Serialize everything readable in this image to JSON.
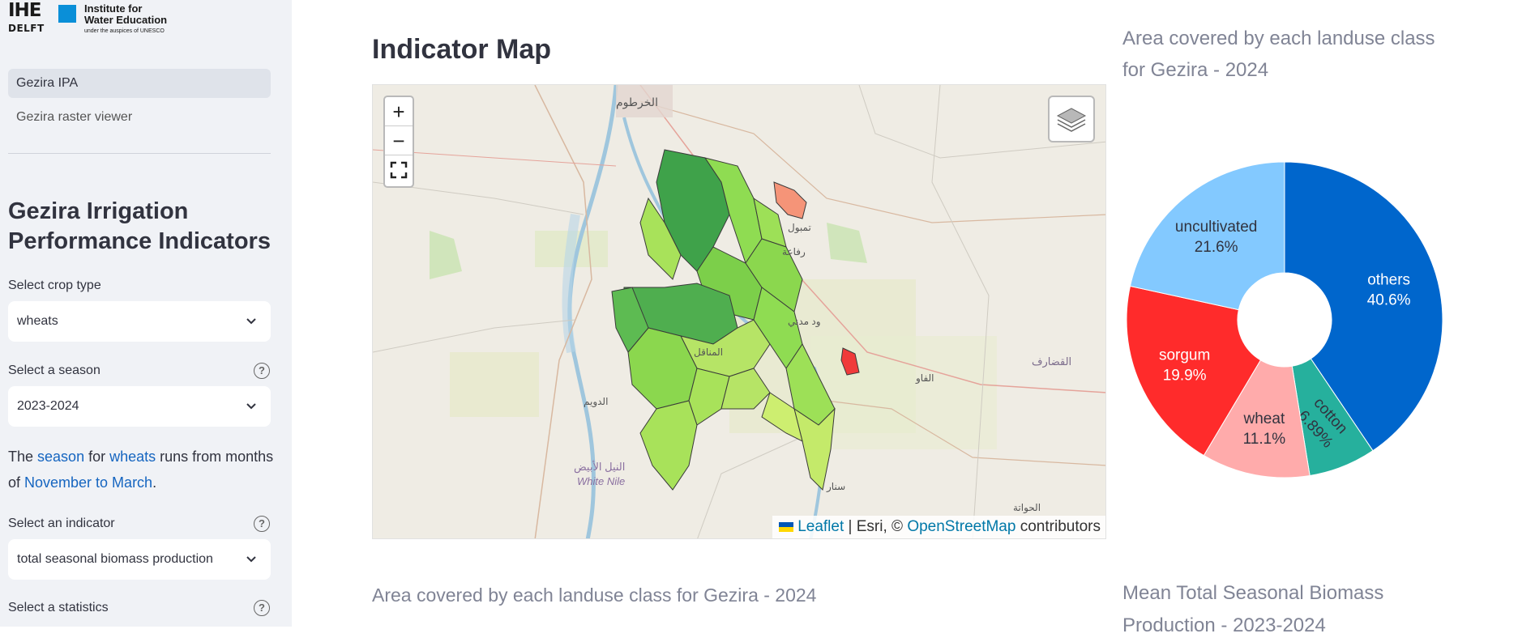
{
  "logo": {
    "ihe": "IHE",
    "delft": "DELFT",
    "line1": "Institute for",
    "line1b": "Water Education",
    "line2": "under the auspices of UNESCO"
  },
  "nav": {
    "items": [
      {
        "label": "Gezira IPA"
      },
      {
        "label": "Gezira raster viewer"
      }
    ]
  },
  "sidebar": {
    "title": "Gezira Irrigation Performance Indicators",
    "crop_label": "Select crop type",
    "crop_value": "wheats",
    "season_label": "Select a season",
    "season_value": "2023-2024",
    "info": {
      "t1": "The ",
      "season": "season",
      "t2": " for ",
      "crop": "wheats",
      "t3": " runs from months of ",
      "months": "November to March",
      "t4": "."
    },
    "indicator_label": "Select an indicator",
    "indicator_value": "total seasonal biomass production",
    "stat_label": "Select a statistics",
    "help": "?",
    "chevron": "⌄"
  },
  "main": {
    "title": "Indicator Map"
  },
  "map": {
    "zoom_in": "+",
    "zoom_out": "−",
    "fullscreen": "⛶",
    "attribution": {
      "leaflet": "Leaflet",
      "sep": " | Esri, © ",
      "osm": "OpenStreetMap",
      "end": " contributors"
    },
    "places": {
      "khartoum": "الخرطوم",
      "tambul": "تمبول",
      "rufaa": "رفاعة",
      "wadmedani": "ود مدني",
      "managil": "المناقل",
      "duwaym": "الدويم",
      "qadarif": "القضارف",
      "fau": "الفاو",
      "sinnar": "سنار",
      "hawata": "الحواتة",
      "white_nile_ar": "النيل الأبيض",
      "white_nile": "White Nile"
    }
  },
  "right": {
    "pie_title": "Area covered by each landuse class for Gezira - 2024",
    "mean_title": "Mean Total Seasonal Biomass Production - 2023-2024"
  },
  "bottom_left": {
    "title": "Area covered by each landuse class for Gezira - 2024"
  },
  "chart_data": {
    "type": "pie",
    "title": "Area covered by each landuse class for Gezira - 2024",
    "hole": true,
    "categories": [
      "others",
      "cotton",
      "wheat",
      "sorgum",
      "uncultivated"
    ],
    "values": [
      40.6,
      6.89,
      11.1,
      19.9,
      21.6
    ],
    "labels": [
      "40.6%",
      "6.89%",
      "11.1%",
      "19.9%",
      "21.6%"
    ],
    "colors": [
      "#0066cc",
      "#26b09d",
      "#ffabab",
      "#ff2b2b",
      "#83c9ff"
    ]
  }
}
